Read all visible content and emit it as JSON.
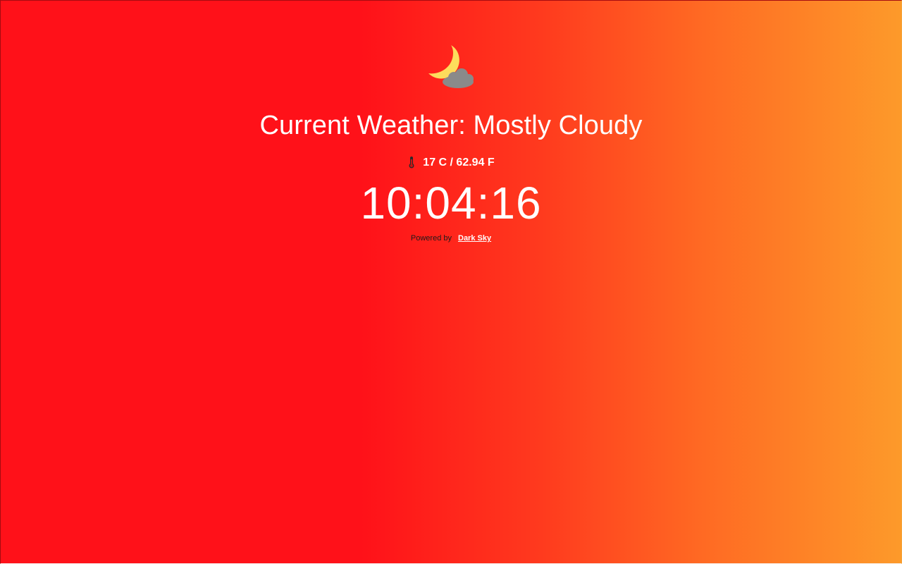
{
  "weather": {
    "icon": "moon-cloud-icon",
    "title": "Current Weather: Mostly Cloudy",
    "temperature": "17 C / 62.94 F",
    "temperature_icon": "thermometer-icon"
  },
  "clock": {
    "time": "10:04:16"
  },
  "footer": {
    "powered_by": "Powered by",
    "link_label": "Dark Sky"
  },
  "colors": {
    "gradient_start": "#ff1119",
    "gradient_end": "#fd9a2a",
    "moon": "#fddc5c",
    "cloud": "#8a8a8a",
    "text": "#ffffff"
  }
}
